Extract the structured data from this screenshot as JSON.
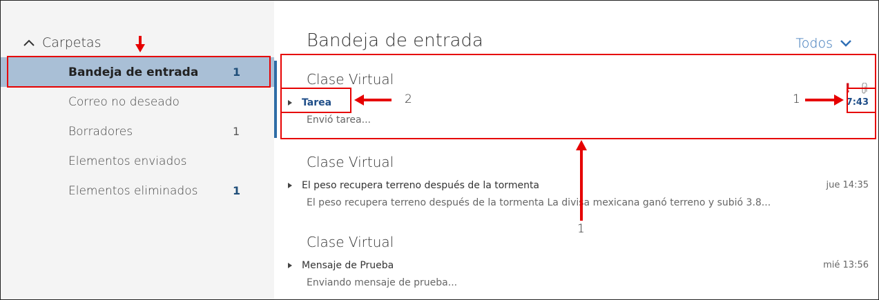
{
  "sidebar": {
    "folders_label": "Carpetas",
    "items": [
      {
        "label": "Bandeja de entrada",
        "count": "1"
      },
      {
        "label": "Correo no deseado",
        "count": ""
      },
      {
        "label": "Borradores",
        "count": "1"
      },
      {
        "label": "Elementos enviados",
        "count": ""
      },
      {
        "label": "Elementos eliminados",
        "count": "1"
      }
    ]
  },
  "main": {
    "title": "Bandeja de entrada",
    "filter_label": "Todos",
    "messages": [
      {
        "sender": "Clase Virtual",
        "subject": "Tarea",
        "preview": "Envió tarea...",
        "time": "7:43",
        "unread": true,
        "important": true,
        "attachment": true
      },
      {
        "sender": "Clase Virtual",
        "subject": "El peso recupera terreno después de la tormenta",
        "preview": "El peso recupera terreno después de la tormenta  La divisa mexicana ganó terreno y subió 3.8...",
        "time": "jue 14:35",
        "unread": false
      },
      {
        "sender": "Clase Virtual",
        "subject": "Mensaje de Prueba",
        "preview": "Enviando mensaje de prueba...",
        "time": "mié 13:56",
        "unread": false
      }
    ]
  },
  "annotations": {
    "label_subject": "2",
    "label_time": "1",
    "label_message": "1",
    "color": "#e60000"
  },
  "colors": {
    "accent": "#2f6fb5",
    "selected_folder_bg": "#a9bfd6",
    "unread_text": "#1f4e88",
    "importance": "#d0101b"
  }
}
